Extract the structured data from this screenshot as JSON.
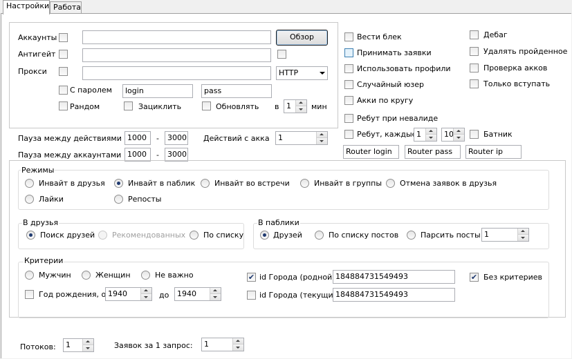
{
  "tabs": [
    "Настройки",
    "Работа"
  ],
  "top": {
    "accounts_label": "Аккаунты",
    "antigate_label": "Антигейт",
    "proxy_label": "Прокси",
    "browse_button": "Обзор",
    "proxy_type": "HTTP",
    "with_password_label": "С паролем",
    "login_value": "login",
    "pass_value": "pass",
    "random_label": "Рандом",
    "loop_label": "Зациклить",
    "refresh_label": "Обновлять",
    "every_label": "в",
    "every_value": "1",
    "min_label": "мин"
  },
  "options": {
    "left": [
      "Вести блек",
      "Принимать заявки",
      "Использовать профили",
      "Случайный юзер",
      "Акки по кругу",
      "Ребут при невалиде"
    ],
    "right": [
      "Дебаг",
      "Удалять пройденное",
      "Проверка акков",
      "Только вступать"
    ],
    "reboot_label": "Ребут, каждые",
    "reboot_a": "1",
    "reboot_b": "10",
    "batnik_label": "Батник",
    "router_login": "Router login",
    "router_pass": "Router pass",
    "router_ip": "Router ip"
  },
  "pauses": {
    "actions_label": "Пауза между действиями",
    "actions_from": "1000",
    "actions_to": "3000",
    "accounts_label": "Пауза между аккаунтами",
    "accounts_from": "1000",
    "accounts_to": "3000",
    "dash": "-",
    "per_account_label": "Действий с акка",
    "per_account_value": "1"
  },
  "modes": {
    "title": "Режимы",
    "items": [
      "Инвайт в друзья",
      "Инвайт в паблик",
      "Инвайт  во встречи",
      "Инвайт  в группы",
      "Отмена заявок в друзья",
      "Лайки",
      "Репосты"
    ]
  },
  "friends": {
    "title": "В друзья",
    "items": [
      "Поиск друзей",
      "Рекомендованных",
      "По списку"
    ]
  },
  "publics": {
    "title": "В паблики",
    "items": [
      "Друзей",
      "По списку постов",
      "Парсить посты"
    ],
    "parse_value": "1"
  },
  "criteria": {
    "title": "Критерии",
    "gender": [
      "Мужчин",
      "Женщин",
      "Не важно"
    ],
    "birth_label": "Год рождения, от",
    "birth_from": "1940",
    "birth_to_label": "до",
    "birth_to": "1940",
    "city_home_label": "id Города (родной)",
    "city_home_value": "184884731549493",
    "city_current_label": "id Города (текущий)",
    "city_current_value": "184884731549493",
    "no_criteria_label": "Без критериев"
  },
  "bottom": {
    "threads_label": "Потоков:",
    "threads_value": "1",
    "requests_label": "Заявок за 1 запрос:",
    "requests_value": "1"
  },
  "glyphs": {
    "check": "✔"
  }
}
